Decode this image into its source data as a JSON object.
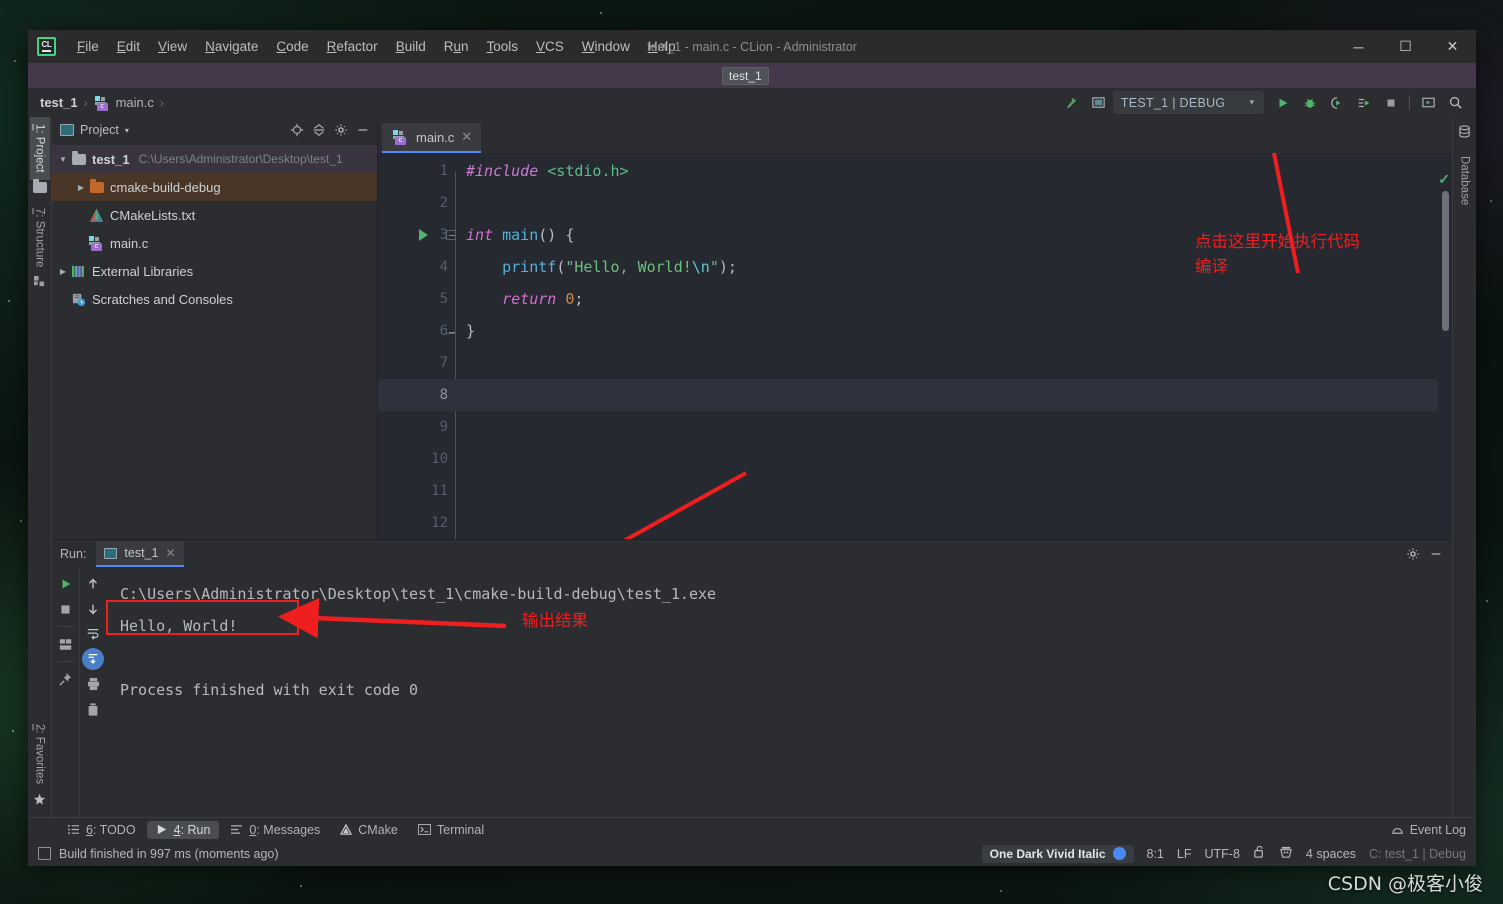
{
  "titlebar": {
    "logo_text": "CL",
    "window_title": "test_1 - main.c - CLion - Administrator",
    "menu": [
      {
        "pre": "",
        "u": "F",
        "post": "ile"
      },
      {
        "pre": "",
        "u": "E",
        "post": "dit"
      },
      {
        "pre": "",
        "u": "V",
        "post": "iew"
      },
      {
        "pre": "",
        "u": "N",
        "post": "avigate"
      },
      {
        "pre": "",
        "u": "C",
        "post": "ode"
      },
      {
        "pre": "",
        "u": "R",
        "post": "efactor"
      },
      {
        "pre": "",
        "u": "B",
        "post": "uild"
      },
      {
        "pre": "R",
        "u": "u",
        "post": "n"
      },
      {
        "pre": "",
        "u": "T",
        "post": "ools"
      },
      {
        "pre": "",
        "u": "V",
        "post": "CS"
      },
      {
        "pre": "",
        "u": "W",
        "post": "indow"
      },
      {
        "pre": "",
        "u": "H",
        "post": "elp"
      }
    ],
    "minimize": "─",
    "maximize": "☐",
    "close": "✕"
  },
  "tooltip": {
    "text": "test_1"
  },
  "navbar": {
    "breadcrumbs": [
      {
        "label": "test_1",
        "sep": "›"
      },
      {
        "label": "main.c",
        "sep": "›"
      }
    ],
    "hammer_icon": "build-hammer",
    "run_config": {
      "label": "TEST_1 | DEBUG",
      "caret": "▾"
    },
    "buttons": [
      "run-button",
      "debug-button",
      "run-with-coverage-button",
      "profile-button",
      "stop-button",
      "run-anything-button",
      "search-everywhere-button"
    ],
    "stop_glyph": "■",
    "search_glyph": "⌕"
  },
  "left_strip": {
    "tabs": [
      {
        "num": "1",
        "label": ": Project",
        "active": true
      },
      {
        "num": "7",
        "label": ": Structure",
        "active": false
      },
      {
        "num": "2",
        "label": ": Favorites",
        "active": false
      }
    ]
  },
  "right_strip": {
    "tabs": [
      {
        "label": "Database"
      }
    ]
  },
  "project_panel": {
    "title": "Project",
    "caret": "▾",
    "tools": [
      "locate-icon",
      "collapse-all-icon",
      "settings-gear-icon",
      "hide-icon"
    ],
    "tree": [
      {
        "indent": 0,
        "twisty": "▼",
        "icon": "folder",
        "color": "#a7acb2",
        "label": "test_1",
        "bold": true,
        "path": "C:\\Users\\Administrator\\Desktop\\test_1",
        "state": "selected"
      },
      {
        "indent": 1,
        "twisty": "▶",
        "icon": "folder",
        "color": "#c4682a",
        "label": "cmake-build-debug",
        "bold": false,
        "path": "",
        "state": "highlight"
      },
      {
        "indent": 1,
        "twisty": "",
        "icon": "cmake",
        "color": "",
        "label": "CMakeLists.txt",
        "bold": false,
        "path": "",
        "state": ""
      },
      {
        "indent": 1,
        "twisty": "",
        "icon": "cfile",
        "color": "",
        "label": "main.c",
        "bold": false,
        "path": "",
        "state": ""
      },
      {
        "indent": 0,
        "twisty": "▶",
        "icon": "libs",
        "color": "",
        "label": "External Libraries",
        "bold": false,
        "path": "",
        "state": ""
      },
      {
        "indent": 0,
        "twisty": "",
        "icon": "scratch",
        "color": "",
        "label": "Scratches and Consoles",
        "bold": false,
        "path": "",
        "state": ""
      }
    ]
  },
  "editor": {
    "tab": {
      "label": "main.c",
      "close": "✕"
    },
    "lines": [
      {
        "n": "1",
        "current": false,
        "runmark": false
      },
      {
        "n": "2",
        "current": false,
        "runmark": false
      },
      {
        "n": "3",
        "current": false,
        "runmark": true
      },
      {
        "n": "4",
        "current": false,
        "runmark": false
      },
      {
        "n": "5",
        "current": false,
        "runmark": false
      },
      {
        "n": "6",
        "current": false,
        "runmark": false
      },
      {
        "n": "7",
        "current": false,
        "runmark": false
      },
      {
        "n": "8",
        "current": true,
        "runmark": false
      },
      {
        "n": "9",
        "current": false,
        "runmark": false
      },
      {
        "n": "10",
        "current": false,
        "runmark": false
      },
      {
        "n": "11",
        "current": false,
        "runmark": false
      },
      {
        "n": "12",
        "current": false,
        "runmark": false
      }
    ],
    "code": {
      "l1_include": "#include",
      "l1_header": "<stdio.h>",
      "l3_int": "int",
      "l3_main": "main",
      "l3_rest": "() {",
      "l4_printf": "    printf",
      "l4_open": "(",
      "l4_str": "\"Hello, World!",
      "l4_esc": "\\n",
      "l4_strend": "\"",
      "l4_close": ");",
      "l5_return": "    return",
      "l5_num": " 0",
      "l5_semi": ";",
      "l6_brace": "}"
    }
  },
  "annotations": {
    "run_note": "点击这里开始执行代码\n编译",
    "output_note": "输出结果",
    "arrow_color": "#ef1f20"
  },
  "run_panel": {
    "header_label": "Run:",
    "tab_label": "test_1",
    "tab_close": "✕",
    "header_tools": [
      "settings-gear-icon",
      "hide-icon"
    ],
    "tools_left": [
      "rerun-button",
      "stop-button",
      "layout-button",
      "pin-button"
    ],
    "tools_right": [
      "up-button",
      "down-button",
      "soft-wrap-button",
      "scroll-to-end-button",
      "print-button",
      "clear-all-button"
    ],
    "console": [
      "C:\\Users\\Administrator\\Desktop\\test_1\\cmake-build-debug\\test_1.exe",
      "Hello, World!",
      "",
      "Process finished with exit code 0"
    ]
  },
  "statusbar_tools": {
    "items": [
      {
        "icon": "list-icon",
        "num": "6",
        "label": ": TODO",
        "active": false
      },
      {
        "icon": "play-icon",
        "num": "4",
        "label": ": Run",
        "active": true
      },
      {
        "icon": "messages-icon",
        "num": "0",
        "label": ": Messages",
        "active": false
      },
      {
        "icon": "cmake-icon",
        "num": "",
        "label": "CMake",
        "active": false
      },
      {
        "icon": "terminal-icon",
        "num": "",
        "label": "Terminal",
        "active": false
      }
    ],
    "event_log": "Event Log"
  },
  "statusbar": {
    "build_message": "Build finished in 997 ms (moments ago)",
    "scheme": "One Dark Vivid Italic",
    "caret_position": "8:1",
    "line_separator": "LF",
    "encoding": "UTF-8",
    "indent": "4 spaces",
    "config": "C: test_1 | Debug",
    "lock_icon": "unlocked-icon",
    "inspection_icon": "inspection-icon"
  },
  "watermark": {
    "text": "CSDN @极客小俊"
  }
}
